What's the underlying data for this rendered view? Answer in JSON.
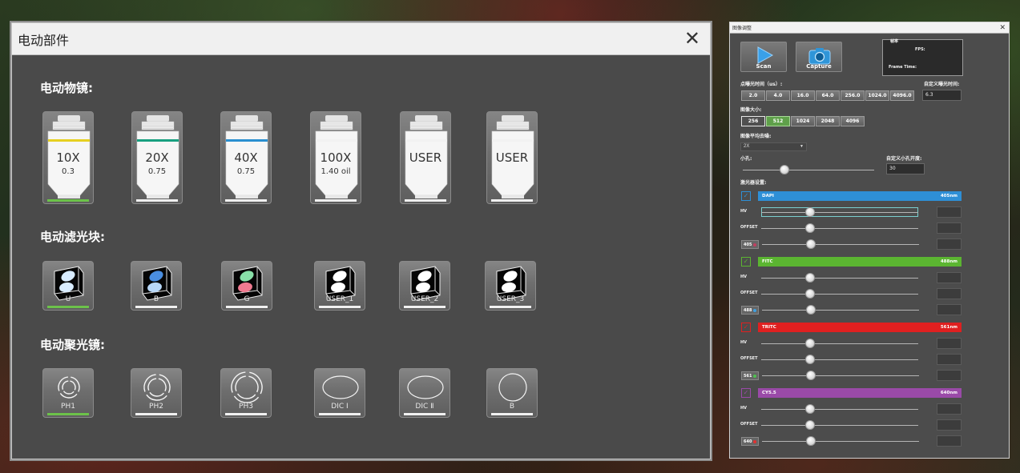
{
  "motor_window": {
    "title": "电动部件",
    "sections": {
      "objective": "电动物镜:",
      "filter": "电动滤光块:",
      "condenser": "电动聚光镜:"
    },
    "objectives": [
      {
        "mag": "10X",
        "na": "0.3",
        "ring": "#e6d020",
        "active": true
      },
      {
        "mag": "20X",
        "na": "0.75",
        "ring": "#18a080",
        "active": false
      },
      {
        "mag": "40X",
        "na": "0.75",
        "ring": "#2a8fd0",
        "active": false
      },
      {
        "mag": "100X",
        "na": "1.40 oil",
        "ring": "#f2f2f2",
        "active": false
      },
      {
        "mag": "USER",
        "na": "",
        "ring": "#f2f2f2",
        "active": false
      },
      {
        "mag": "USER",
        "na": "",
        "ring": "#f2f2f2",
        "active": false
      }
    ],
    "filters": [
      {
        "label": "U",
        "top": "#d8ecff",
        "bottom": "#d8ecff",
        "active": true
      },
      {
        "label": "B",
        "top": "#4a8ee0",
        "bottom": "#b8d8f8",
        "active": false
      },
      {
        "label": "G",
        "top": "#88e0a8",
        "bottom": "#f07a90",
        "active": false
      },
      {
        "label": "USER_1",
        "top": "#ffffff",
        "bottom": "#ffffff",
        "active": false
      },
      {
        "label": "USER_2",
        "top": "#ffffff",
        "bottom": "#ffffff",
        "active": false
      },
      {
        "label": "USER_3",
        "top": "#ffffff",
        "bottom": "#ffffff",
        "active": false
      }
    ],
    "condensers": [
      {
        "label": "PH1",
        "icon": "ph-ring-small-icon",
        "active": true
      },
      {
        "label": "PH2",
        "icon": "ph-ring-medium-icon",
        "active": false
      },
      {
        "label": "PH3",
        "icon": "ph-ring-large-icon",
        "active": false
      },
      {
        "label": "DIC Ⅰ",
        "icon": "dic-ellipse-icon",
        "active": false
      },
      {
        "label": "DIC Ⅱ",
        "icon": "dic-ellipse-icon",
        "active": false
      },
      {
        "label": "B",
        "icon": "bright-field-circle-icon",
        "active": false
      }
    ]
  },
  "image_window": {
    "title": "图像调整",
    "scan_label": "Scan",
    "capture_label": "Capture",
    "fps_group": "帧率",
    "fps_label": "FPS:",
    "frame_time_label": "Frame Time:",
    "dwell_label": "点曝光时间（us）:",
    "custom_dwell_label": "自定义曝光时间:",
    "dwell_options": [
      "2.0",
      "4.0",
      "16.0",
      "64.0",
      "256.0",
      "1024.0",
      "4096.0"
    ],
    "custom_dwell_value": "6.3",
    "size_label": "图像大小:",
    "size_options": [
      "256",
      "512",
      "1024",
      "2048",
      "4096"
    ],
    "size_selected": "512",
    "avg_label": "图像平均去噪:",
    "avg_value": "2X",
    "pinhole_label": "小孔:",
    "pinhole_custom_label": "自定义小孔开度:",
    "pinhole_value": "30",
    "pinhole_level": 0.32,
    "laser_label": "激光器设置:",
    "hv_label": "HV",
    "offset_label": "OFFSET",
    "channels": [
      {
        "name": "DAPI",
        "wl": "405nm",
        "color": "#2e8fd6",
        "wl_short": "405",
        "dot": "#c04060",
        "hv": 0.31,
        "offset": 0.31,
        "power": 0.31,
        "focused": true
      },
      {
        "name": "FITC",
        "wl": "488nm",
        "color": "#5bb531",
        "wl_short": "488",
        "dot": "#40a0e0",
        "hv": 0.31,
        "offset": 0.31,
        "power": 0.31,
        "focused": false
      },
      {
        "name": "TRITC",
        "wl": "561nm",
        "color": "#e02020",
        "wl_short": "561",
        "dot": "#50c050",
        "hv": 0.31,
        "offset": 0.31,
        "power": 0.31,
        "focused": false
      },
      {
        "name": "CY5.5",
        "wl": "640nm",
        "color": "#9a4aa8",
        "wl_short": "640",
        "dot": "#e03030",
        "hv": 0.31,
        "offset": 0.31,
        "power": 0.31,
        "focused": false
      }
    ]
  }
}
